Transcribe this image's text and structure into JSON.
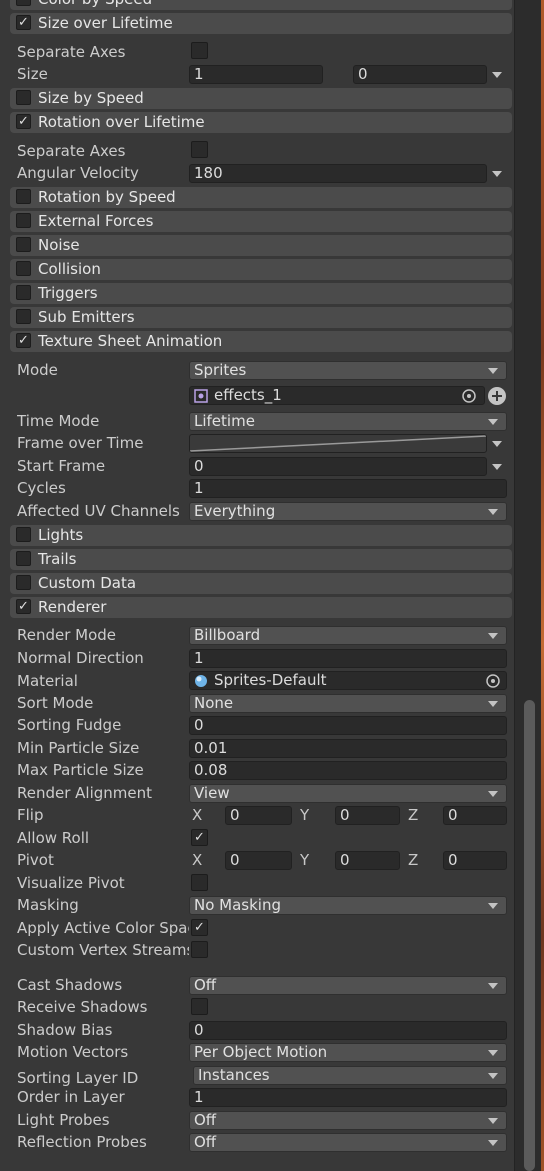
{
  "modules": {
    "color_by_speed": "Color by Speed",
    "size_over_lifetime": "Size over Lifetime",
    "size_by_speed": "Size by Speed",
    "rotation_over_lifetime": "Rotation over Lifetime",
    "rotation_by_speed": "Rotation by Speed",
    "external_forces": "External Forces",
    "noise": "Noise",
    "collision": "Collision",
    "triggers": "Triggers",
    "sub_emitters": "Sub Emitters",
    "texture_sheet_animation": "Texture Sheet Animation",
    "lights": "Lights",
    "trails": "Trails",
    "custom_data": "Custom Data",
    "renderer": "Renderer"
  },
  "check_glyph": "✓",
  "size_over_lifetime": {
    "separate_axes": "Separate Axes",
    "size": "Size",
    "size_min": "1",
    "size_max": "0"
  },
  "rotation_over_lifetime": {
    "separate_axes": "Separate Axes",
    "angular_velocity": "Angular Velocity",
    "angular_velocity_value": "180"
  },
  "texture_sheet": {
    "mode_label": "Mode",
    "mode_value": "Sprites",
    "sprite_value": "effects_1",
    "time_mode_label": "Time Mode",
    "time_mode_value": "Lifetime",
    "frame_over_time_label": "Frame over Time",
    "start_frame_label": "Start Frame",
    "start_frame_value": "0",
    "cycles_label": "Cycles",
    "cycles_value": "1",
    "uv_channels_label": "Affected UV Channels",
    "uv_channels_value": "Everything"
  },
  "renderer": {
    "render_mode_label": "Render Mode",
    "render_mode_value": "Billboard",
    "normal_direction_label": "Normal Direction",
    "normal_direction_value": "1",
    "material_label": "Material",
    "material_value": "Sprites-Default",
    "sort_mode_label": "Sort Mode",
    "sort_mode_value": "None",
    "sorting_fudge_label": "Sorting Fudge",
    "sorting_fudge_value": "0",
    "min_particle_size_label": "Min Particle Size",
    "min_particle_size_value": "0.01",
    "max_particle_size_label": "Max Particle Size",
    "max_particle_size_value": "0.08",
    "render_alignment_label": "Render Alignment",
    "render_alignment_value": "View",
    "flip_label": "Flip",
    "flip_x": "0",
    "flip_y": "0",
    "flip_z": "0",
    "allow_roll_label": "Allow Roll",
    "pivot_label": "Pivot",
    "pivot_x": "0",
    "pivot_y": "0",
    "pivot_z": "0",
    "visualize_pivot_label": "Visualize Pivot",
    "masking_label": "Masking",
    "masking_value": "No Masking",
    "apply_active_color_label": "Apply Active Color Space",
    "custom_vertex_streams_label": "Custom Vertex Streams",
    "cast_shadows_label": "Cast Shadows",
    "cast_shadows_value": "Off",
    "receive_shadows_label": "Receive Shadows",
    "shadow_bias_label": "Shadow Bias",
    "shadow_bias_value": "0",
    "motion_vectors_label": "Motion Vectors",
    "motion_vectors_value": "Per Object Motion",
    "sorting_layer_label": "Sorting Layer ID",
    "sorting_layer_value": "Instances",
    "order_in_layer_label": "Order in Layer",
    "order_in_layer_value": "1",
    "light_probes_label": "Light Probes",
    "light_probes_value": "Off",
    "reflection_probes_label": "Reflection Probes",
    "reflection_probes_value": "Off"
  },
  "axes": {
    "x": "X",
    "y": "Y",
    "z": "Z"
  }
}
